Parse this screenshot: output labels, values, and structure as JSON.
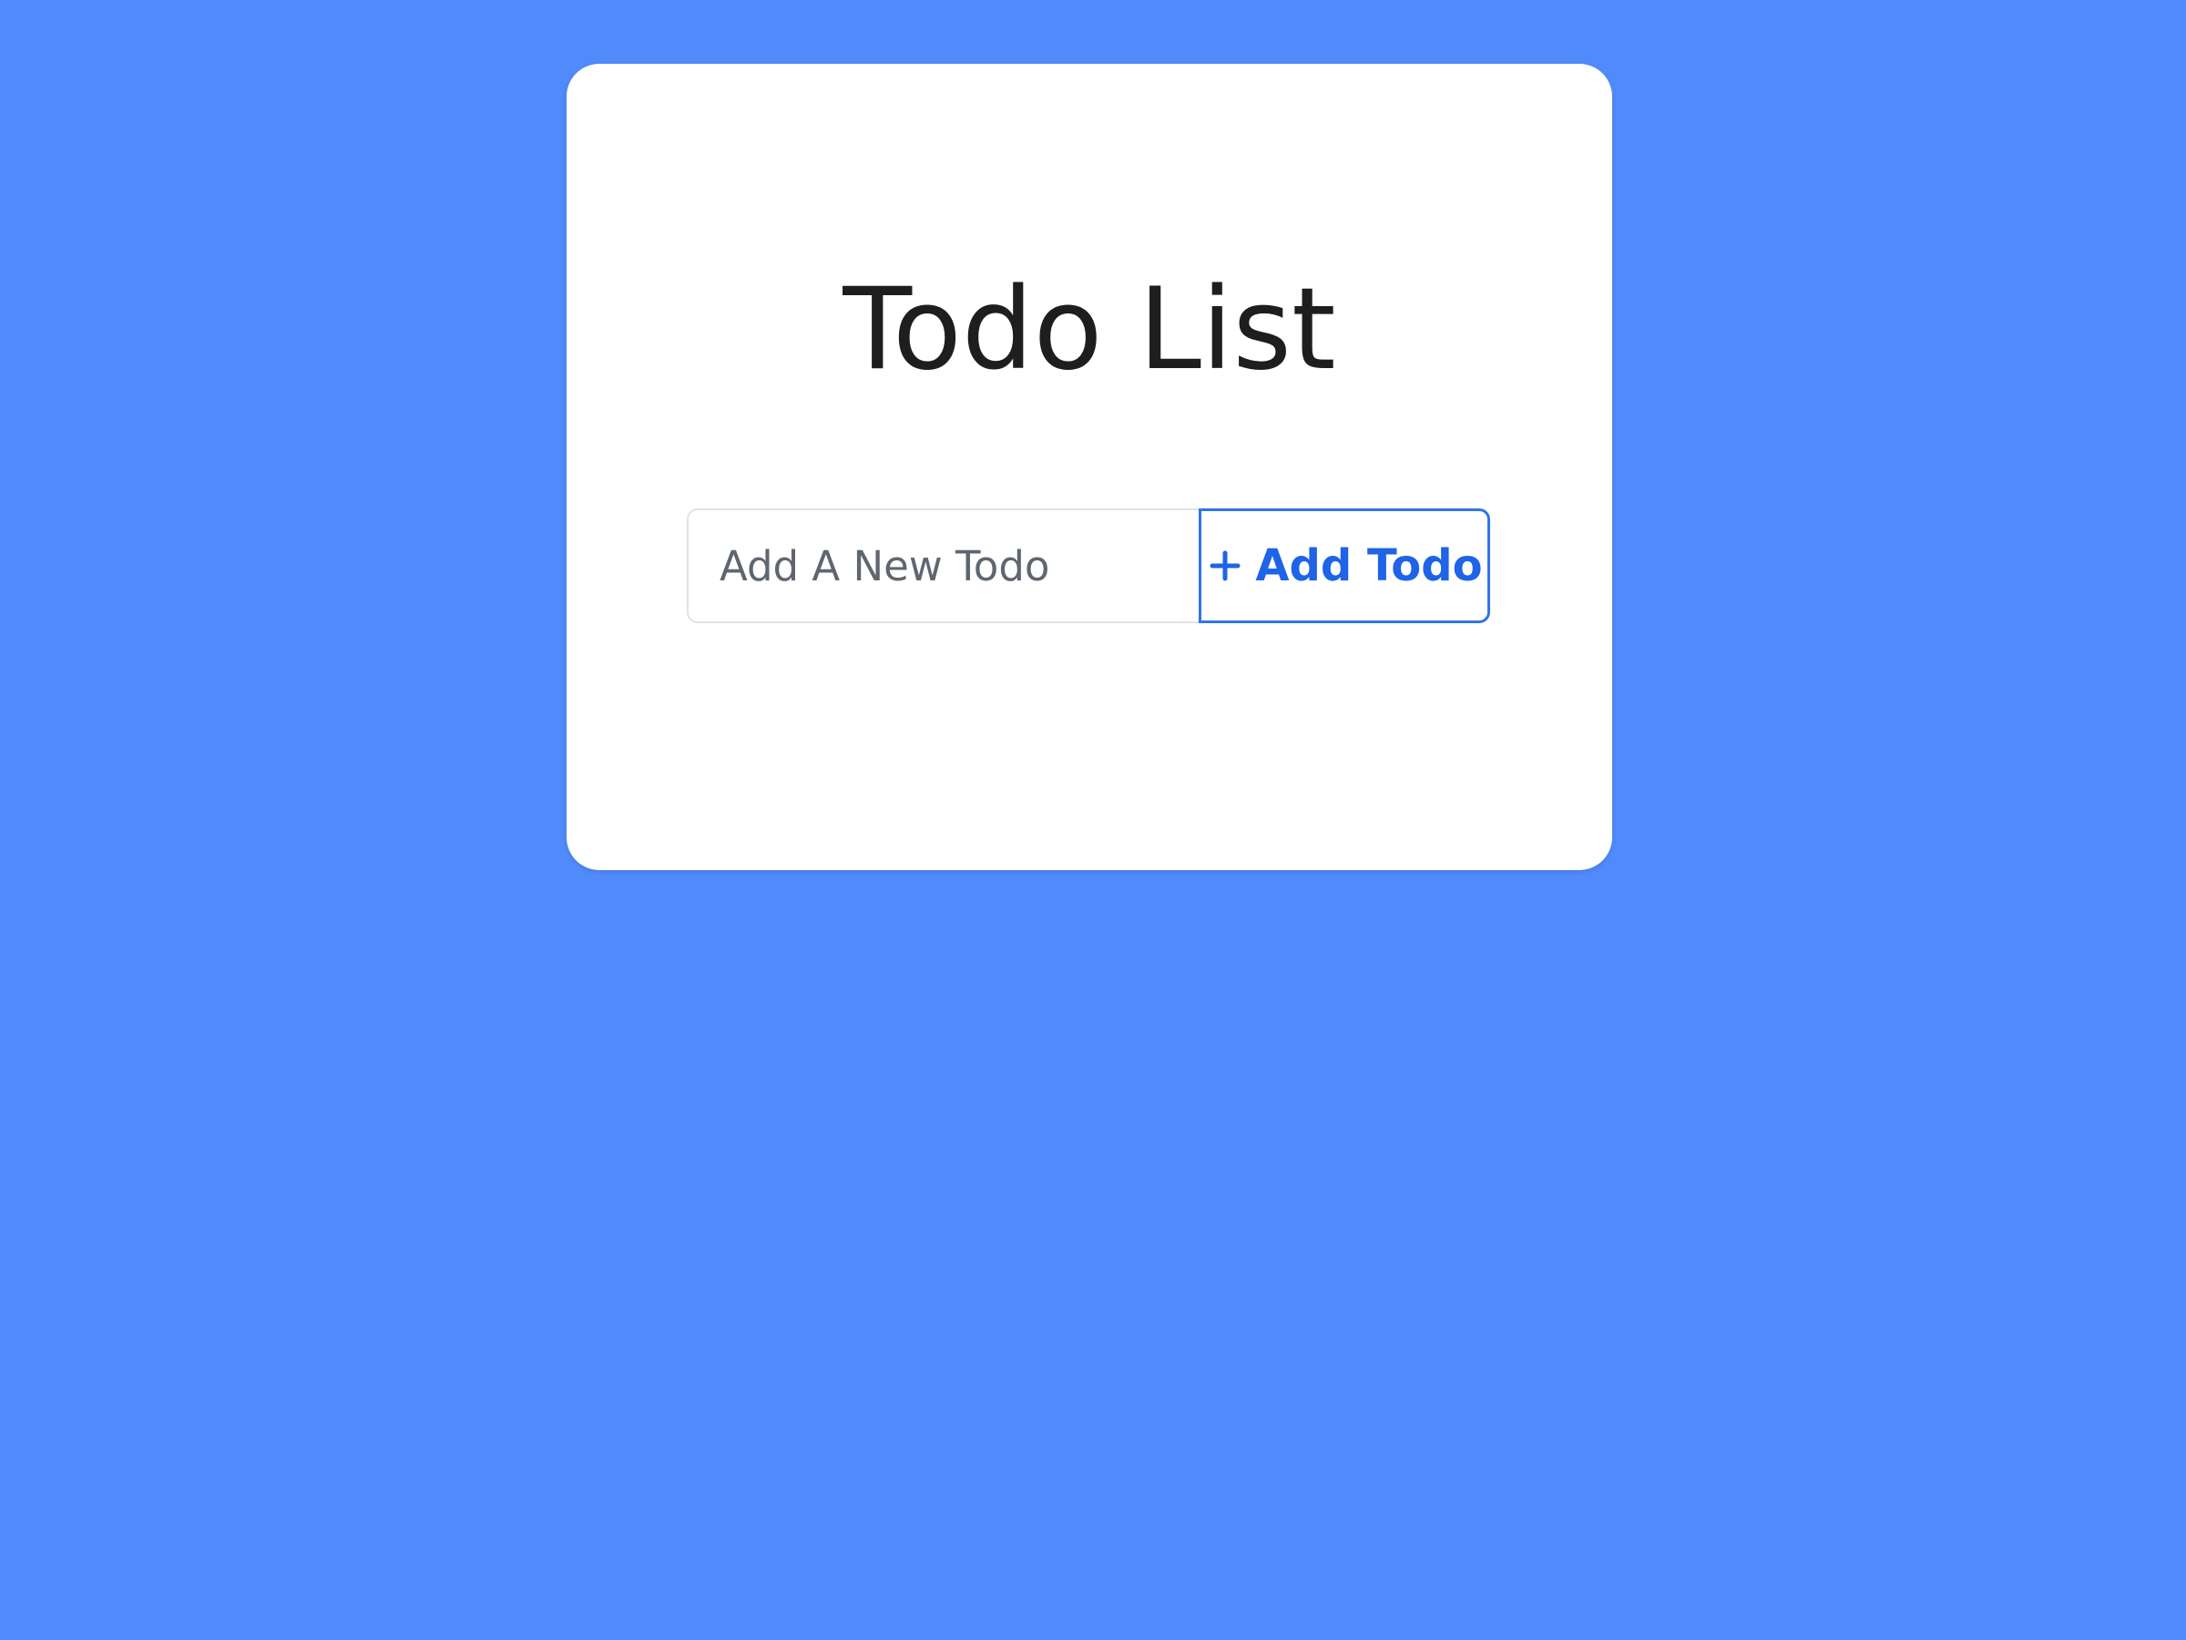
{
  "page": {
    "title": "Todo List"
  },
  "form": {
    "input_placeholder": "Add A New Todo",
    "input_value": "",
    "add_button_label": "Add Todo",
    "add_button_icon": "plus-icon"
  },
  "colors": {
    "background": "#508afb",
    "card": "#ffffff",
    "accent": "#1f63e6",
    "button_border": "#2f74ea",
    "title": "#1e1e1e"
  }
}
